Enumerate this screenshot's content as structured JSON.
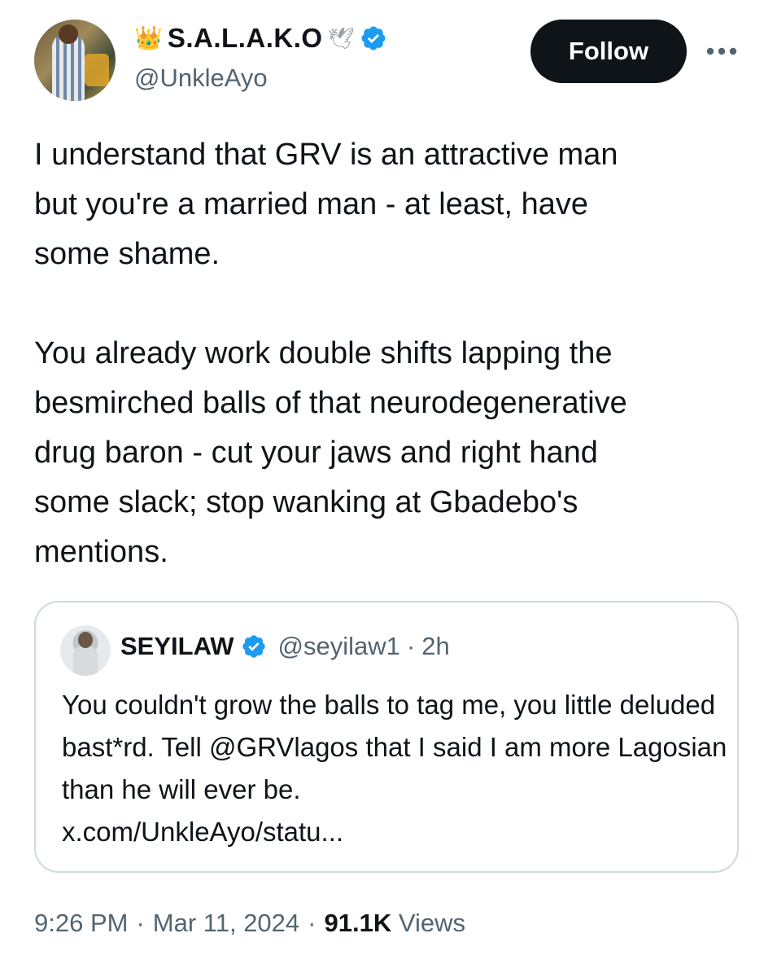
{
  "author": {
    "display_name": "S.A.L.A.K.O",
    "crown_glyph": "👑",
    "dove_glyph": "🕊",
    "handle": "@UnkleAyo",
    "verified": true
  },
  "actions": {
    "follow_label": "Follow",
    "more_label": "•••"
  },
  "tweet": {
    "text": "I understand that GRV is an attractive man\nbut you're a married man - at least, have\nsome shame.\n\nYou already work double shifts lapping the\nbesmirched balls of that neurodegenerative\ndrug baron - cut your jaws and right hand\nsome slack; stop wanking at Gbadebo's\nmentions."
  },
  "quote": {
    "name": "SEYILAW",
    "handle": "@seyilaw1",
    "separator": "·",
    "time": "2h",
    "text": "You couldn't grow the balls to tag me, you little deluded bast*rd. Tell @GRVlagos that I said I am more Lagosian than he will ever be.",
    "link": "x.com/UnkleAyo/statu..."
  },
  "meta": {
    "time": "9:26 PM",
    "sep1": "·",
    "date": "Mar 11, 2024",
    "sep2": "·",
    "views_count": "91.1K",
    "views_label": "Views"
  },
  "colors": {
    "text": "#0f1419",
    "secondary": "#536471",
    "verified_blue": "#1d9bf0",
    "border": "#cfd9de"
  }
}
